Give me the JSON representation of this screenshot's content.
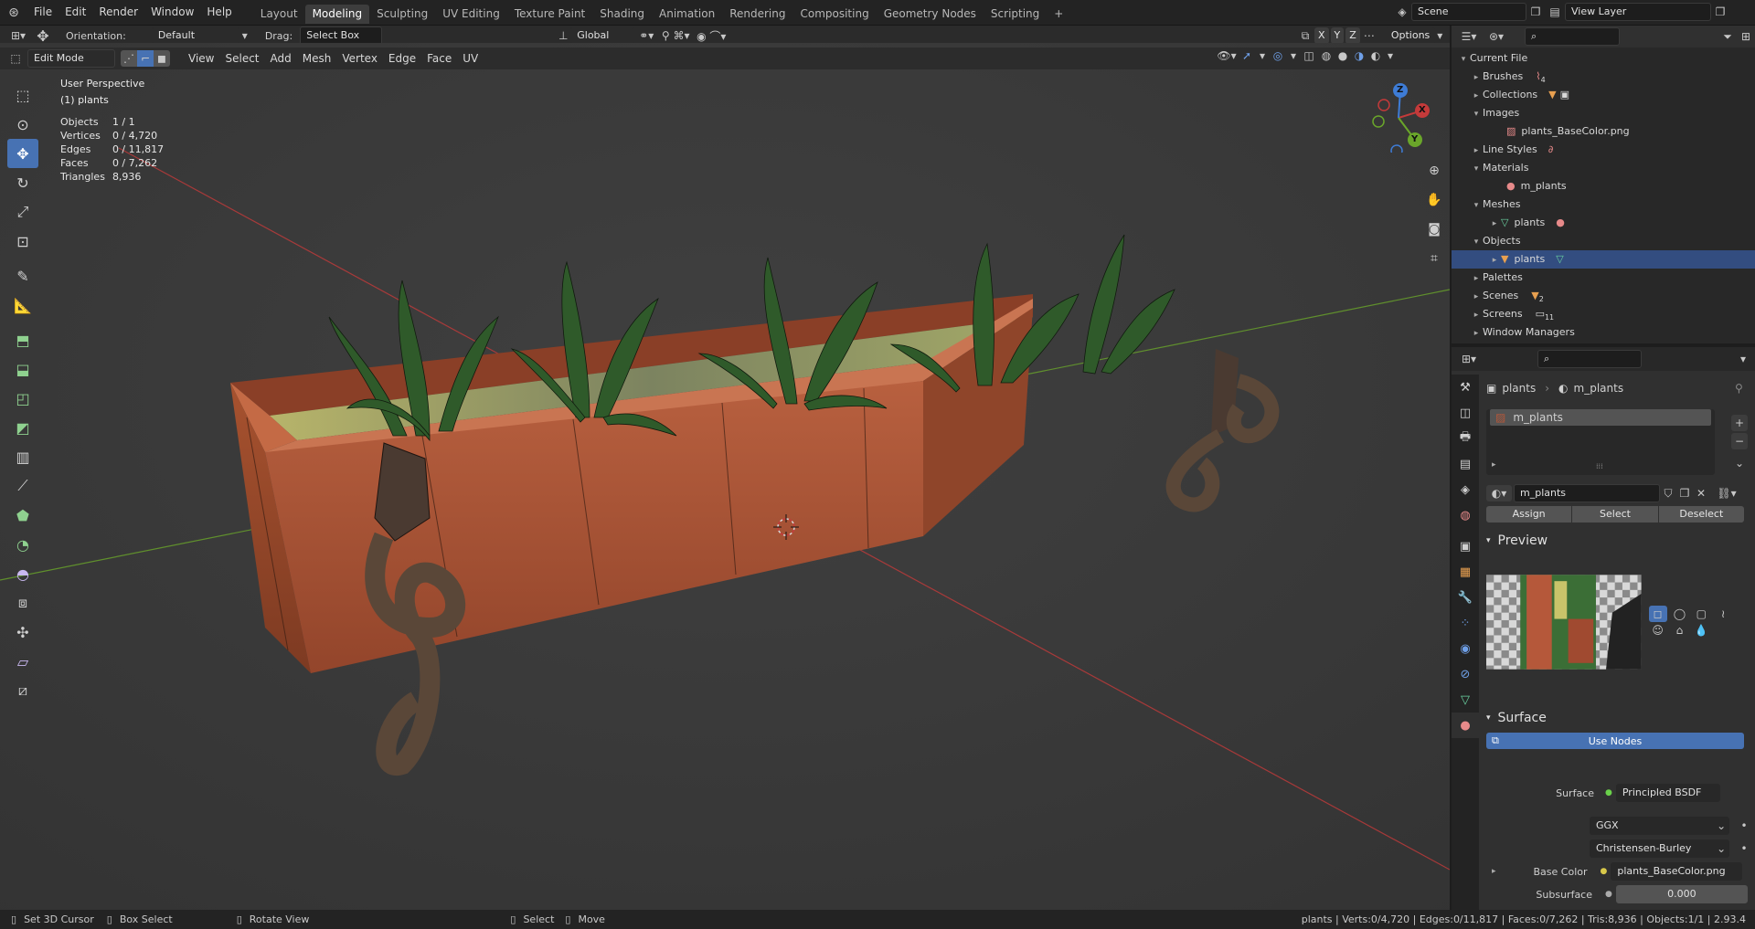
{
  "topbar": {
    "menus": [
      "File",
      "Edit",
      "Render",
      "Window",
      "Help"
    ],
    "workspaces": [
      "Layout",
      "Modeling",
      "Sculpting",
      "UV Editing",
      "Texture Paint",
      "Shading",
      "Animation",
      "Rendering",
      "Compositing",
      "Geometry Nodes",
      "Scripting"
    ],
    "active_workspace": "Modeling",
    "add_workspace": "+",
    "scene": "Scene",
    "view_layer": "View Layer"
  },
  "tool_header": {
    "orientation_label": "Orientation:",
    "orientation_value": "Default",
    "drag_label": "Drag:",
    "drag_value": "Select Box",
    "transform_space": "Global",
    "axes": [
      "X",
      "Y",
      "Z"
    ],
    "options": "Options"
  },
  "viewport_header": {
    "mode": "Edit Mode",
    "menus": [
      "View",
      "Select",
      "Add",
      "Mesh",
      "Vertex",
      "Edge",
      "Face",
      "UV"
    ]
  },
  "overlay": {
    "view_name": "User Perspective",
    "object_name": "(1) plants",
    "stats": [
      {
        "label": "Objects",
        "value": "1 / 1"
      },
      {
        "label": "Vertices",
        "value": "0 / 4,720"
      },
      {
        "label": "Edges",
        "value": "0 / 11,817"
      },
      {
        "label": "Faces",
        "value": "0 / 7,262"
      },
      {
        "label": "Triangles",
        "value": "8,936"
      }
    ]
  },
  "gizmo": {
    "x": "X",
    "y": "Y",
    "z": "Z"
  },
  "outliner": {
    "root": "Current File",
    "items": [
      {
        "label": "Brushes",
        "badge": "4",
        "level": 1,
        "expanded": false
      },
      {
        "label": "Collections",
        "level": 1,
        "expanded": false
      },
      {
        "label": "Images",
        "level": 1,
        "expanded": true
      },
      {
        "label": "plants_BaseColor.png",
        "level": 2
      },
      {
        "label": "Line Styles",
        "level": 1,
        "expanded": false
      },
      {
        "label": "Materials",
        "level": 1,
        "expanded": true
      },
      {
        "label": "m_plants",
        "level": 2
      },
      {
        "label": "Meshes",
        "level": 1,
        "expanded": true
      },
      {
        "label": "plants",
        "level": 2
      },
      {
        "label": "Objects",
        "level": 1,
        "expanded": true
      },
      {
        "label": "plants",
        "level": 2,
        "selected": true
      },
      {
        "label": "Palettes",
        "level": 1,
        "expanded": false
      },
      {
        "label": "Scenes",
        "badge": "2",
        "level": 1,
        "expanded": false
      },
      {
        "label": "Screens",
        "badge": "11",
        "level": 1,
        "expanded": false
      },
      {
        "label": "Window Managers",
        "level": 1,
        "expanded": false
      }
    ]
  },
  "properties": {
    "breadcrumb_object": "plants",
    "breadcrumb_material": "m_plants",
    "slot": "m_plants",
    "material_name": "m_plants",
    "assign": "Assign",
    "select": "Select",
    "deselect": "Deselect",
    "preview_title": "Preview",
    "surface_title": "Surface",
    "use_nodes": "Use Nodes",
    "surface_label": "Surface",
    "surface_value": "Principled BSDF",
    "distribution": "GGX",
    "subsurface_method": "Christensen-Burley",
    "base_color_label": "Base Color",
    "base_color_value": "plants_BaseColor.png",
    "subsurface_label": "Subsurface",
    "subsurface_value": "0.000"
  },
  "statusbar": {
    "set_cursor": "Set 3D Cursor",
    "box_select": "Box Select",
    "rotate_view": "Rotate View",
    "select": "Select",
    "move": "Move",
    "stats": "plants | Verts:0/4,720 | Edges:0/11,817 | Faces:0/7,262 | Tris:8,936 | Objects:1/1 | 2.93.4"
  },
  "colors": {
    "accent": "#4772b3",
    "planter": "#b5583a",
    "leaf": "#2f5a2a",
    "x_axis": "#c43a3a",
    "y_axis": "#6aa62a",
    "z_axis": "#3e7cd6"
  }
}
